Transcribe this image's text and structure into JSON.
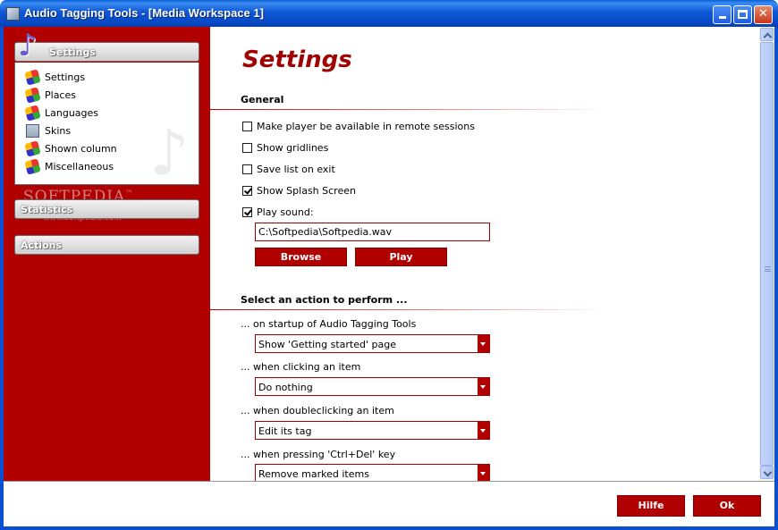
{
  "window": {
    "title": "Audio Tagging Tools - [Media Workspace 1]"
  },
  "sidebar": {
    "settings_header": "Settings",
    "items": [
      {
        "label": "Settings",
        "icon": "tools-icon"
      },
      {
        "label": "Places",
        "icon": "tools-icon"
      },
      {
        "label": "Languages",
        "icon": "tools-icon"
      },
      {
        "label": "Skins",
        "icon": "skin-icon"
      },
      {
        "label": "Shown column",
        "icon": "tools-icon"
      },
      {
        "label": "Miscellaneous",
        "icon": "tools-icon"
      }
    ],
    "statistics_header": "Statistics",
    "actions_header": "Actions",
    "watermark": "SOFTPEDIA",
    "watermark_tm": "™",
    "watermark_url": "www.softpedia.com"
  },
  "main": {
    "title": "Settings",
    "general": {
      "label": "General",
      "options": [
        {
          "label": "Make player be available in remote sessions",
          "checked": false
        },
        {
          "label": "Show gridlines",
          "checked": false
        },
        {
          "label": "Save list on exit",
          "checked": false
        },
        {
          "label": "Show Splash Screen",
          "checked": true
        },
        {
          "label": "Play sound:",
          "checked": true
        }
      ],
      "sound_path": "C:\\Softpedia\\Softpedia.wav",
      "browse_label": "Browse",
      "play_label": "Play"
    },
    "actions": {
      "label": "Select an action to perform ...",
      "rows": [
        {
          "label": "... on startup of Audio Tagging Tools",
          "value": "Show 'Getting started' page"
        },
        {
          "label": "... when clicking an item",
          "value": "Do nothing"
        },
        {
          "label": "... when doubleclicking an item",
          "value": "Edit its tag"
        },
        {
          "label": "... when pressing 'Ctrl+Del' key",
          "value": "Remove marked items"
        }
      ]
    }
  },
  "footer": {
    "help_label": "Hilfe",
    "ok_label": "Ok"
  },
  "colors": {
    "accent": "#b00000",
    "titlebar": "#0a5fd8"
  }
}
